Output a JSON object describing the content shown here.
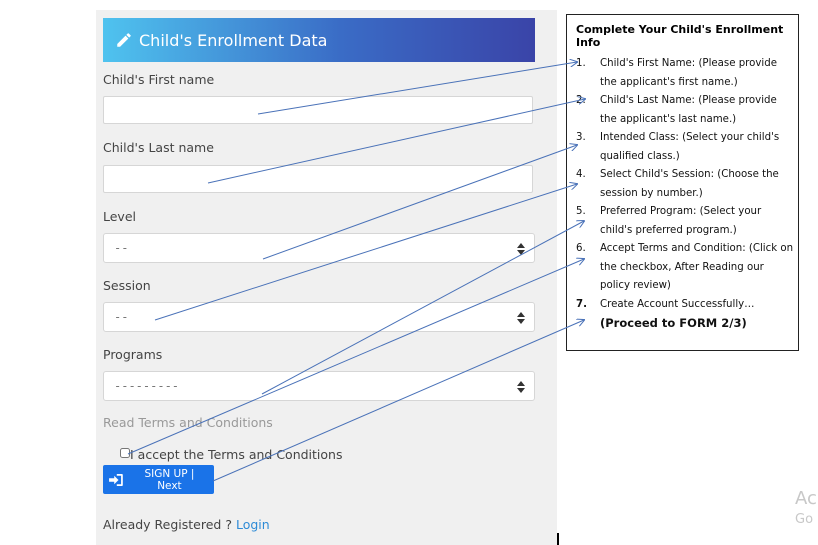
{
  "form": {
    "title": "Child's Enrollment Data",
    "first_name_label": "Child's First name",
    "first_name_value": "",
    "last_name_label": "Child's Last name",
    "last_name_value": "",
    "level_label": "Level",
    "level_value": "--",
    "session_label": "Session",
    "session_value": "--",
    "programs_label": "Programs",
    "programs_value": "---------",
    "terms_link": "Read Terms and Conditions",
    "accept_label": "I accept the Terms and Conditions",
    "signup_label": "SIGN UP | Next",
    "already_text": "Already Registered ? ",
    "login_label": "Login"
  },
  "info": {
    "title": "Complete Your Child's Enrollment Info",
    "items": [
      {
        "num": "1.",
        "text": "Child's First Name: (Please provide the applicant's first name.)"
      },
      {
        "num": "2.",
        "text": "Child's Last Name: (Please provide the applicant's last name.)"
      },
      {
        "num": "3.",
        "text": "Intended Class: (Select your child's qualified class.)"
      },
      {
        "num": "4.",
        "text": "Select Child's Session: (Choose the session by number.)"
      },
      {
        "num": "5.",
        "text": "Preferred Program: (Select your child's preferred program.)"
      },
      {
        "num": "6.",
        "text": "Accept Terms and Condition: (Click on the checkbox, After Reading our policy review)"
      },
      {
        "num": "7.",
        "text": "Create Account Successfully…",
        "sub": "(Proceed to FORM 2/3)"
      }
    ]
  },
  "watermark": {
    "line1": "Ac",
    "line2": "Go"
  },
  "colors": {
    "accent": "#1a73e8",
    "header_start": "#4fc3ef",
    "header_end": "#3a44a8",
    "arrow": "#4a72b8",
    "link": "#2e8bd6"
  }
}
